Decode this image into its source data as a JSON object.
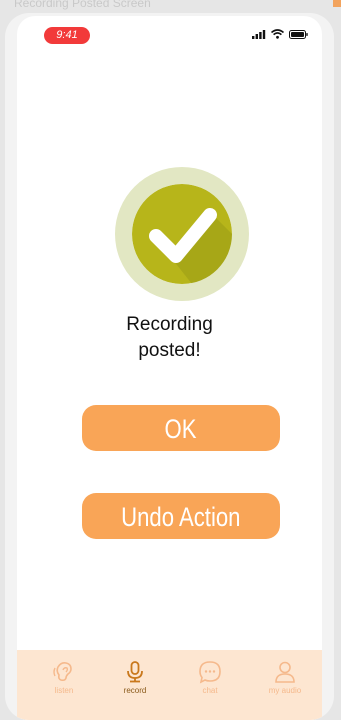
{
  "page_caption": "Recording Posted Screen",
  "status_bar": {
    "time": "9:41"
  },
  "message": {
    "line1": "Recording",
    "line2": "posted!"
  },
  "buttons": {
    "ok": "OK",
    "undo": "Undo Action"
  },
  "nav": [
    {
      "label": "listen",
      "icon": "ear-icon",
      "active": false
    },
    {
      "label": "record",
      "icon": "microphone-icon",
      "active": true
    },
    {
      "label": "chat",
      "icon": "chat-bubble-icon",
      "active": false
    },
    {
      "label": "my audio",
      "icon": "user-icon",
      "active": false
    }
  ],
  "colors": {
    "accent": "#f9a557",
    "success_ring": "#e2e7c3",
    "success_circle": "#b7b51a",
    "nav_background": "#fde6d1",
    "time_pill": "#f23a3a"
  }
}
